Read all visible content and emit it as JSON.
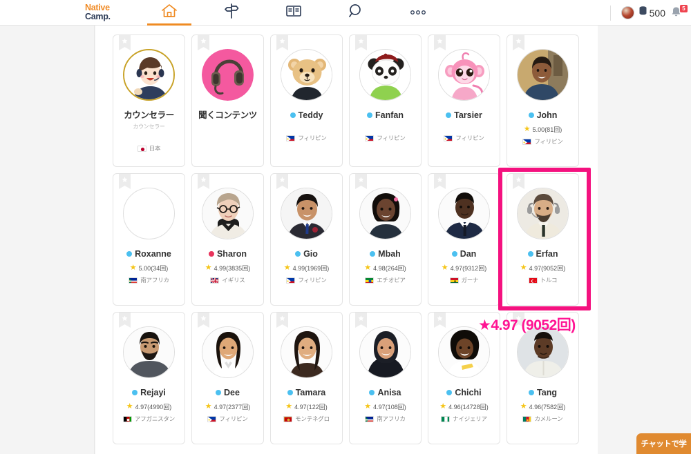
{
  "header": {
    "logo_line1": "Native",
    "logo_line2": "Camp.",
    "nav": [
      {
        "name": "home",
        "icon": "home-icon",
        "active": true
      },
      {
        "name": "signpost",
        "icon": "signpost-icon",
        "active": false
      },
      {
        "name": "book",
        "icon": "book-icon",
        "active": false
      },
      {
        "name": "search",
        "icon": "search-icon",
        "active": false
      },
      {
        "name": "more",
        "icon": "more-dots-icon",
        "active": false
      }
    ],
    "coin_count": "500",
    "notification_badge": "5"
  },
  "annotation": {
    "text": "★4.97 (9052回)",
    "color": "#ff1493"
  },
  "highlight": {
    "target": "Erfan",
    "color": "#f4117f"
  },
  "chat_button": {
    "label": "チャットで学"
  },
  "cards": [
    {
      "name": "カウンセラー",
      "sub": "カウンセラー",
      "kind": "counselor",
      "dot": null,
      "rating": null,
      "country": "日本",
      "flag": "jp",
      "avatar": "counselor-avatar",
      "spaced": true
    },
    {
      "name": "聞くコンテンツ",
      "sub": null,
      "kind": "content",
      "dot": null,
      "rating": null,
      "country": null,
      "flag": null,
      "avatar": "headphones-avatar",
      "spaced": false
    },
    {
      "name": "Teddy",
      "sub": null,
      "kind": "tutor",
      "dot": "#4bc0f0",
      "rating": null,
      "country": "フィリピン",
      "flag": "ph",
      "avatar": "teddy-bear-avatar",
      "spaced": true
    },
    {
      "name": "Fanfan",
      "sub": null,
      "kind": "tutor",
      "dot": "#4bc0f0",
      "rating": null,
      "country": "フィリピン",
      "flag": "ph",
      "avatar": "panda-avatar",
      "spaced": true
    },
    {
      "name": "Tarsier",
      "sub": null,
      "kind": "tutor",
      "dot": "#4bc0f0",
      "rating": null,
      "country": "フィリピン",
      "flag": "ph",
      "avatar": "monkey-avatar",
      "spaced": true
    },
    {
      "name": "John",
      "sub": null,
      "kind": "tutor",
      "dot": "#4bc0f0",
      "rating": "5.00(81回)",
      "country": "フィリピン",
      "flag": "ph",
      "avatar": "john-photo",
      "spaced": false
    },
    {
      "name": "Roxanne",
      "sub": null,
      "kind": "tutor",
      "dot": "#4bc0f0",
      "rating": "5.00(34回)",
      "country": "南アフリカ",
      "flag": "za",
      "avatar": "roxanne-photo",
      "spaced": false
    },
    {
      "name": "Sharon",
      "sub": null,
      "kind": "tutor",
      "dot": "#e8345c",
      "rating": "4.99(3835回)",
      "country": "イギリス",
      "flag": "gb",
      "avatar": "sharon-photo",
      "spaced": false
    },
    {
      "name": "Gio",
      "sub": null,
      "kind": "tutor",
      "dot": "#4bc0f0",
      "rating": "4.99(1969回)",
      "country": "フィリピン",
      "flag": "ph",
      "avatar": "gio-photo",
      "spaced": false
    },
    {
      "name": "Mbah",
      "sub": null,
      "kind": "tutor",
      "dot": "#4bc0f0",
      "rating": "4.98(264回)",
      "country": "エチオピア",
      "flag": "et",
      "avatar": "mbah-photo",
      "spaced": false
    },
    {
      "name": "Dan",
      "sub": null,
      "kind": "tutor",
      "dot": "#4bc0f0",
      "rating": "4.97(9312回)",
      "country": "ガーナ",
      "flag": "gh",
      "avatar": "dan-photo",
      "spaced": false
    },
    {
      "name": "Erfan",
      "sub": null,
      "kind": "tutor",
      "dot": "#4bc0f0",
      "rating": "4.97(9052回)",
      "country": "トルコ",
      "flag": "tr",
      "avatar": "erfan-photo",
      "spaced": false
    },
    {
      "name": "Rejayi",
      "sub": null,
      "kind": "tutor",
      "dot": "#4bc0f0",
      "rating": "4.97(4990回)",
      "country": "アフガニスタン",
      "flag": "af",
      "avatar": "rejayi-photo",
      "spaced": false
    },
    {
      "name": "Dee",
      "sub": null,
      "kind": "tutor",
      "dot": "#4bc0f0",
      "rating": "4.97(2377回)",
      "country": "フィリピン",
      "flag": "ph",
      "avatar": "dee-photo",
      "spaced": false
    },
    {
      "name": "Tamara",
      "sub": null,
      "kind": "tutor",
      "dot": "#4bc0f0",
      "rating": "4.97(122回)",
      "country": "モンテネグロ",
      "flag": "me",
      "avatar": "tamara-photo",
      "spaced": false
    },
    {
      "name": "Anisa",
      "sub": null,
      "kind": "tutor",
      "dot": "#4bc0f0",
      "rating": "4.97(108回)",
      "country": "南アフリカ",
      "flag": "za",
      "avatar": "anisa-photo",
      "spaced": false
    },
    {
      "name": "Chichi",
      "sub": null,
      "kind": "tutor",
      "dot": "#4bc0f0",
      "rating": "4.96(14728回)",
      "country": "ナイジェリア",
      "flag": "ng",
      "avatar": "chichi-photo",
      "spaced": false
    },
    {
      "name": "Tang",
      "sub": null,
      "kind": "tutor",
      "dot": "#4bc0f0",
      "rating": "4.96(7582回)",
      "country": "カメルーン",
      "flag": "cm",
      "avatar": "tang-photo",
      "spaced": false
    }
  ]
}
